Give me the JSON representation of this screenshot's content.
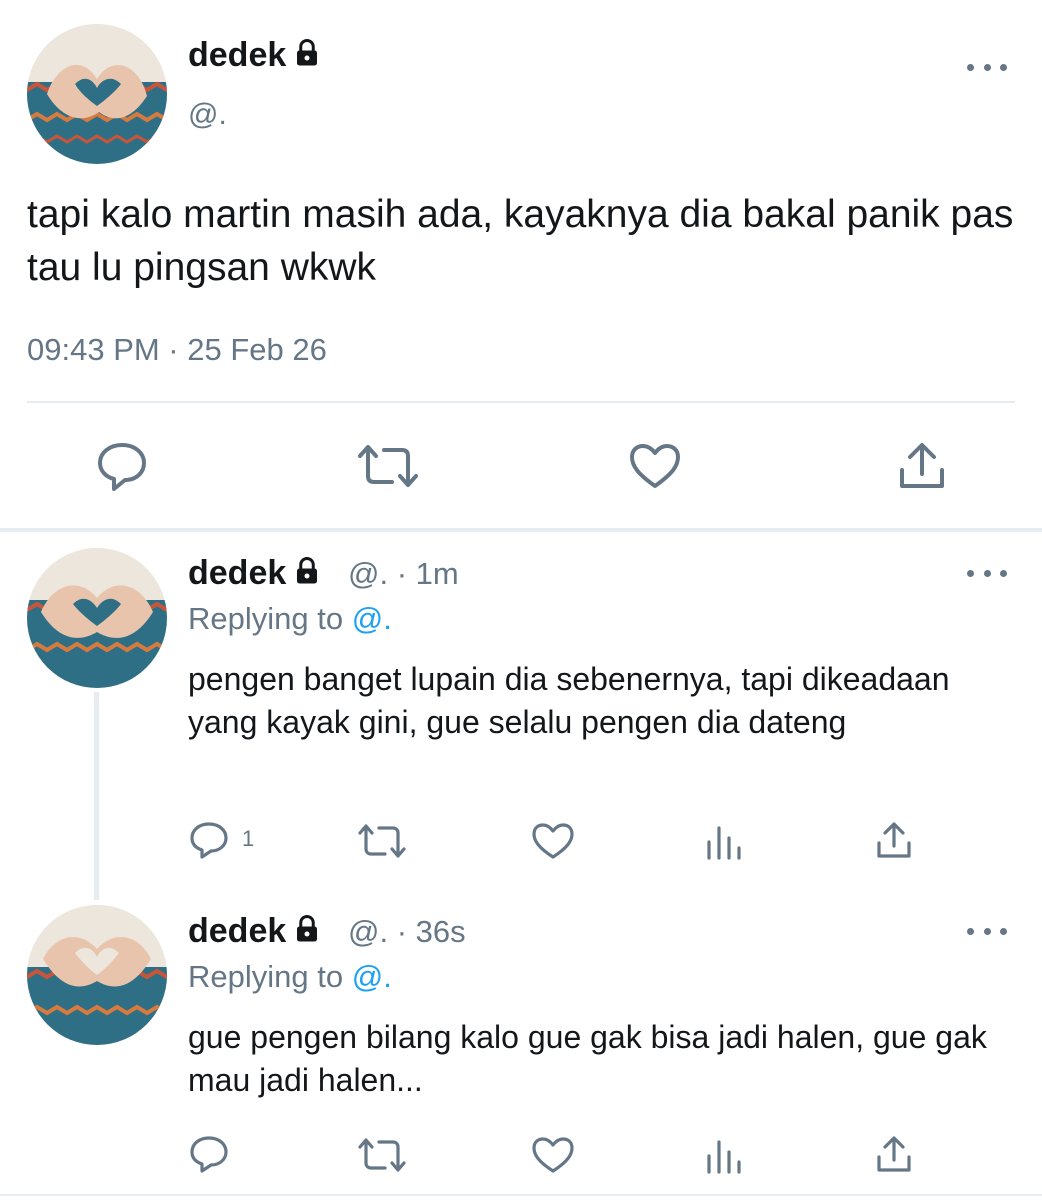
{
  "main_tweet": {
    "display_name": "dedek",
    "handle": "@.",
    "text": "tapi kalo martin masih ada, kayaknya dia bakal panik pas tau lu pingsan wkwk",
    "timestamp": "09:43 PM · 25 Feb 26",
    "actions": [
      "reply-icon",
      "retweet-icon",
      "like-icon",
      "share-icon"
    ]
  },
  "replies": [
    {
      "display_name": "dedek",
      "meta": "@. · 1m",
      "replying_label": "Replying to",
      "replying_to": "@.",
      "text": "pengen banget lupain dia sebenernya, tapi dikeadaan yang kayak gini, gue selalu pengen dia dateng",
      "reply_count": "1",
      "actions": [
        "reply-icon",
        "retweet-icon",
        "like-icon",
        "analytics-icon",
        "share-icon"
      ]
    },
    {
      "display_name": "dedek",
      "meta": "@. · 36s",
      "replying_label": "Replying to",
      "replying_to": "@.",
      "text": "gue pengen bilang kalo gue gak bisa jadi halen, gue gak mau jadi halen...",
      "reply_count": "",
      "actions": [
        "reply-icon",
        "retweet-icon",
        "like-icon",
        "analytics-icon",
        "share-icon"
      ]
    }
  ],
  "colors": {
    "text": "#14171a",
    "muted": "#657786",
    "link": "#1da1f2",
    "divider": "#e6ecf0"
  }
}
